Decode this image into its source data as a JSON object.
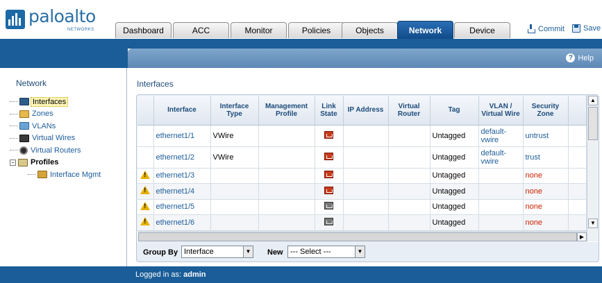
{
  "brand": {
    "name": "paloalto",
    "sub": "NETWORKS"
  },
  "tabs": [
    "Dashboard",
    "ACC",
    "Monitor",
    "Policies",
    "Objects",
    "Network",
    "Device"
  ],
  "active_tab": "Network",
  "header_actions": {
    "commit": "Commit",
    "save": "Save"
  },
  "help": "Help",
  "sidebar": {
    "title": "Network",
    "items": [
      {
        "label": "Interfaces",
        "icon": "interfaces-icon",
        "selected": true
      },
      {
        "label": "Zones",
        "icon": "zones-icon"
      },
      {
        "label": "VLANs",
        "icon": "vlans-icon"
      },
      {
        "label": "Virtual Wires",
        "icon": "virtual-wires-icon"
      },
      {
        "label": "Virtual Routers",
        "icon": "virtual-routers-icon"
      },
      {
        "label": "Profiles",
        "icon": "profiles-icon",
        "expander": "−"
      },
      {
        "label": "Interface Mgmt",
        "icon": "interface-mgmt-icon"
      }
    ]
  },
  "panel_title": "Interfaces",
  "table": {
    "columns": [
      "",
      "Interface",
      "Interface Type",
      "Management Profile",
      "Link State",
      "IP Address",
      "Virtual Router",
      "Tag",
      "VLAN / Virtual Wire",
      "Security Zone",
      ""
    ],
    "rows": [
      {
        "warning": false,
        "interface": "ethernet1/1",
        "type": "VWire",
        "mgmt": "",
        "link": "down",
        "ip": "",
        "vrouter": "",
        "tag": "Untagged",
        "vlan": "default-\nvwire",
        "zone": "untrust"
      },
      {
        "warning": false,
        "interface": "ethernet1/2",
        "type": "VWire",
        "mgmt": "",
        "link": "down",
        "ip": "",
        "vrouter": "",
        "tag": "Untagged",
        "vlan": "default-\nvwire",
        "zone": "trust"
      },
      {
        "warning": true,
        "interface": "ethernet1/3",
        "type": "",
        "mgmt": "",
        "link": "down",
        "ip": "",
        "vrouter": "",
        "tag": "Untagged",
        "vlan": "",
        "zone": "none"
      },
      {
        "warning": true,
        "interface": "ethernet1/4",
        "type": "",
        "mgmt": "",
        "link": "down",
        "ip": "",
        "vrouter": "",
        "tag": "Untagged",
        "vlan": "",
        "zone": "none"
      },
      {
        "warning": true,
        "interface": "ethernet1/5",
        "type": "",
        "mgmt": "",
        "link": "unknown",
        "ip": "",
        "vrouter": "",
        "tag": "Untagged",
        "vlan": "",
        "zone": "none"
      },
      {
        "warning": true,
        "interface": "ethernet1/6",
        "type": "",
        "mgmt": "",
        "link": "unknown",
        "ip": "",
        "vrouter": "",
        "tag": "Untagged",
        "vlan": "",
        "zone": "none"
      }
    ]
  },
  "footer": {
    "group_by_label": "Group By",
    "group_by_value": "Interface",
    "new_label": "New",
    "new_value": "--- Select ---"
  },
  "status": {
    "logged_in_label": "Logged in as:",
    "user": "admin"
  },
  "colors": {
    "brand_blue": "#1a5d98",
    "active_tab": "#1b5c9e",
    "none_zone": "#cc2200",
    "link_blue": "#1d5c9a"
  }
}
